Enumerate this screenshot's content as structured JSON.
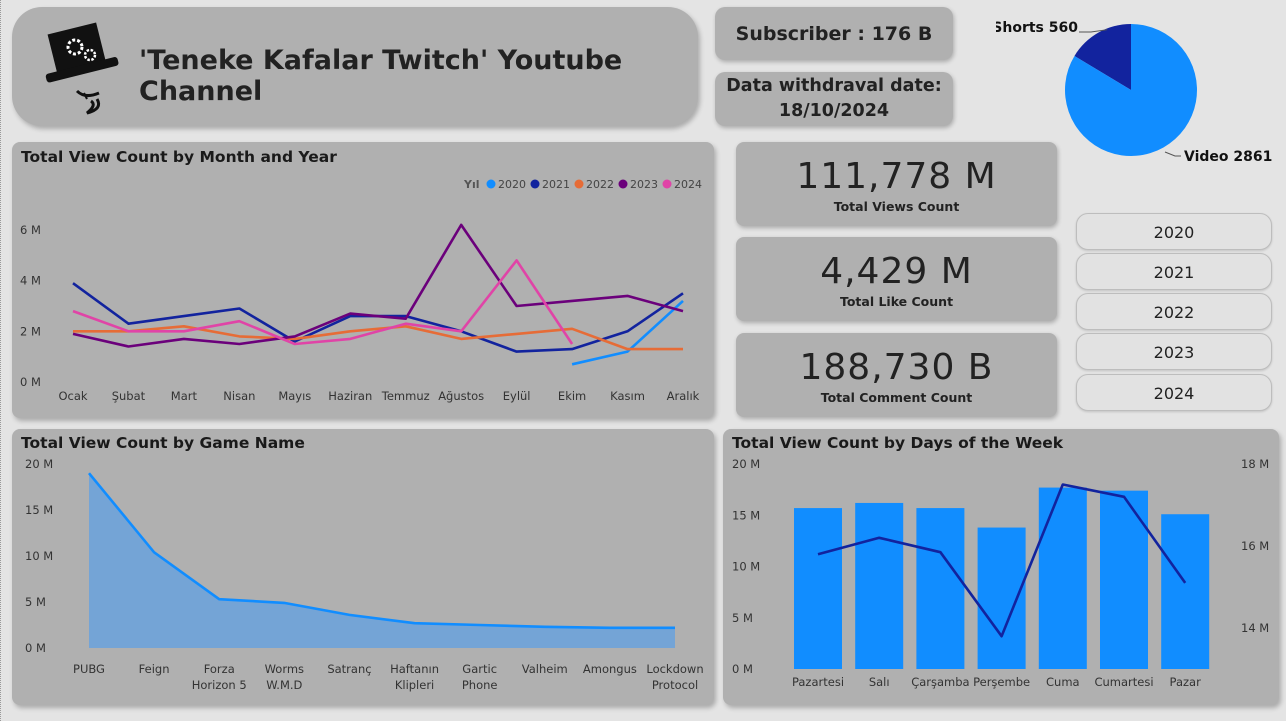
{
  "header": {
    "title": "'Teneke Kafalar Twitch' Youtube Channel",
    "subscriber": "Subscriber : 176 B",
    "withdrawal_label": "Data withdraval date:",
    "withdrawal_date": "18/10/2024"
  },
  "kpis": [
    {
      "value": "111,778 M",
      "label": "Total Views Count"
    },
    {
      "value": "4,429 M",
      "label": "Total Like Count"
    },
    {
      "value": "188,730 B",
      "label": "Total Comment Count"
    }
  ],
  "year_slicer": [
    "2020",
    "2021",
    "2022",
    "2023",
    "2024"
  ],
  "colors": {
    "2020": "#118DFF",
    "2021": "#12239E",
    "2022": "#E66C37",
    "2023": "#6B007B",
    "2024": "#E044A7",
    "area": "#118DFF",
    "bar": "#118DFF",
    "line": "#12239E"
  },
  "chart_data": [
    {
      "type": "pie",
      "slices": [
        {
          "label": "Shorts",
          "value": 560,
          "text": "Shorts 560",
          "color": "#12239E"
        },
        {
          "label": "Video",
          "value": 2861,
          "text": "Video 2861",
          "color": "#118DFF"
        }
      ]
    },
    {
      "type": "line",
      "title": "Total View Count by Month and Year",
      "legend_title": "Yıl",
      "categories": [
        "Ocak",
        "Şubat",
        "Mart",
        "Nisan",
        "Mayıs",
        "Haziran",
        "Temmuz",
        "Ağustos",
        "Eylül",
        "Ekim",
        "Kasım",
        "Aralık"
      ],
      "y_ticks": [
        "0 M",
        "2 M",
        "4 M",
        "6 M"
      ],
      "ylim": [
        0,
        6.0
      ],
      "series": [
        {
          "name": "2020",
          "values": [
            null,
            null,
            null,
            null,
            null,
            null,
            null,
            null,
            null,
            0.7,
            1.2,
            3.2
          ]
        },
        {
          "name": "2021",
          "values": [
            3.9,
            2.3,
            2.6,
            2.9,
            1.6,
            2.6,
            2.6,
            2.0,
            1.2,
            1.3,
            2.0,
            3.5
          ]
        },
        {
          "name": "2022",
          "values": [
            2.0,
            2.0,
            2.2,
            1.8,
            1.7,
            2.0,
            2.2,
            1.7,
            1.9,
            2.1,
            1.3,
            1.3
          ]
        },
        {
          "name": "2023",
          "values": [
            1.9,
            1.4,
            1.7,
            1.5,
            1.8,
            2.7,
            2.5,
            6.2,
            3.0,
            3.2,
            3.4,
            2.8
          ]
        },
        {
          "name": "2024",
          "values": [
            2.8,
            2.0,
            2.0,
            2.4,
            1.5,
            1.7,
            2.3,
            2.0,
            4.8,
            1.5,
            null,
            null
          ]
        }
      ]
    },
    {
      "type": "area",
      "title": "Total View Count by Game Name",
      "categories": [
        "PUBG",
        "Feign",
        "Forza Horizon 5",
        "Worms W.M.D",
        "Satranç",
        "Haftanın Klipleri",
        "Gartic Phone",
        "Valheim",
        "Amongus",
        "Lockdown Protocol"
      ],
      "category_lines": [
        [
          "PUBG"
        ],
        [
          "Feign"
        ],
        [
          "Forza",
          "Horizon 5"
        ],
        [
          "Worms",
          "W.M.D"
        ],
        [
          "Satranç"
        ],
        [
          "Haftanın",
          "Klipleri"
        ],
        [
          "Gartic",
          "Phone"
        ],
        [
          "Valheim"
        ],
        [
          "Amongus"
        ],
        [
          "Lockdown",
          "Protocol"
        ]
      ],
      "values": [
        19.0,
        10.4,
        5.3,
        4.9,
        3.6,
        2.7,
        2.5,
        2.3,
        2.2,
        2.2
      ],
      "y_ticks": [
        "0 M",
        "5 M",
        "10 M",
        "15 M",
        "20 M"
      ],
      "ylim": [
        0,
        20
      ]
    },
    {
      "type": "bar",
      "title": "Total View Count by Days of the Week",
      "categories": [
        "Pazartesi",
        "Salı",
        "Çarşamba",
        "Perşembe",
        "Cuma",
        "Cumartesi",
        "Pazar"
      ],
      "bar_values": [
        15.7,
        16.2,
        15.7,
        13.8,
        17.7,
        17.4,
        15.1
      ],
      "line_values": [
        15.8,
        16.2,
        15.85,
        13.8,
        17.5,
        17.2,
        15.1
      ],
      "y_ticks": [
        "0 M",
        "5 M",
        "10 M",
        "15 M",
        "20 M"
      ],
      "ylim": [
        0,
        20
      ],
      "y2_ticks": [
        "14 M",
        "16 M",
        "18 M"
      ],
      "y2lim": [
        13.0,
        18.0
      ]
    }
  ]
}
